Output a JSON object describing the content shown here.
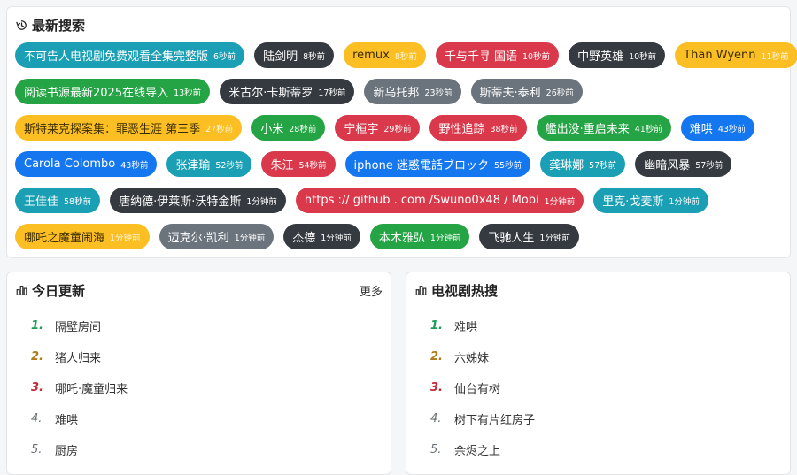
{
  "recent": {
    "title": "最新搜索",
    "rows": [
      [
        {
          "text": "不可告人电视剧免费观看全集完整版",
          "time": "6秒前",
          "color": "teal"
        },
        {
          "text": "陆剑明",
          "time": "8秒前",
          "color": "dark"
        },
        {
          "text": "remux",
          "time": "8秒前",
          "color": "yellow"
        },
        {
          "text": "千与千寻 国语",
          "time": "10秒前",
          "color": "red"
        },
        {
          "text": "中野英雄",
          "time": "10秒前",
          "color": "dark"
        },
        {
          "text": "Than Wyenn",
          "time": "11秒前",
          "color": "yellow"
        }
      ],
      [
        {
          "text": "阅读书源最新2025在线导入",
          "time": "13秒前",
          "color": "green"
        },
        {
          "text": "米古尔·卡斯蒂罗",
          "time": "17秒前",
          "color": "dark"
        },
        {
          "text": "新乌托邦",
          "time": "23秒前",
          "color": "gray"
        },
        {
          "text": "斯蒂夫·泰利",
          "time": "26秒前",
          "color": "gray"
        }
      ],
      [
        {
          "text": "斯特莱克探案集：罪恶生涯 第三季",
          "time": "27秒前",
          "color": "yellow"
        },
        {
          "text": "小米",
          "time": "28秒前",
          "color": "green"
        },
        {
          "text": "宁桓宇",
          "time": "29秒前",
          "color": "red"
        },
        {
          "text": "野性追踪",
          "time": "38秒前",
          "color": "red"
        },
        {
          "text": "艦出没·重启未来",
          "time": "41秒前",
          "color": "green"
        },
        {
          "text": "难哄",
          "time": "43秒前",
          "color": "blue"
        }
      ],
      [
        {
          "text": "Carola Colombo",
          "time": "43秒前",
          "color": "blue"
        },
        {
          "text": "张津瑜",
          "time": "52秒前",
          "color": "teal"
        },
        {
          "text": "朱江",
          "time": "54秒前",
          "color": "red"
        },
        {
          "text": "iphone 迷惑電話ブロック",
          "time": "55秒前",
          "color": "blue"
        },
        {
          "text": "龚琳娜",
          "time": "57秒前",
          "color": "teal"
        },
        {
          "text": "幽暗风暴",
          "time": "57秒前",
          "color": "dark"
        }
      ],
      [
        {
          "text": "王佳佳",
          "time": "58秒前",
          "color": "teal"
        },
        {
          "text": "唐纳德·伊莱斯·沃特金斯",
          "time": "1分钟前",
          "color": "dark"
        },
        {
          "text": "https :// github . com /Swuno0x48 / Mobi",
          "time": "1分钟前",
          "color": "red"
        },
        {
          "text": "里克·戈麦斯",
          "time": "1分钟前",
          "color": "teal"
        }
      ],
      [
        {
          "text": "哪吒之魔童闹海",
          "time": "1分钟前",
          "color": "yellow"
        },
        {
          "text": "迈克尔·凯利",
          "time": "1分钟前",
          "color": "gray"
        },
        {
          "text": "杰德",
          "time": "1分钟前",
          "color": "dark"
        },
        {
          "text": "本木雅弘",
          "time": "1分钟前",
          "color": "green"
        },
        {
          "text": "飞驰人生",
          "time": "1分钟前",
          "color": "dark"
        }
      ]
    ]
  },
  "today": {
    "title": "今日更新",
    "more": "更多",
    "items": [
      {
        "rank": "1.",
        "name": "隔壁房间"
      },
      {
        "rank": "2.",
        "name": "猪人归来"
      },
      {
        "rank": "3.",
        "name": "哪吒·魔童归来"
      },
      {
        "rank": "4.",
        "name": "难哄"
      },
      {
        "rank": "5.",
        "name": "厨房"
      }
    ]
  },
  "tvhot": {
    "title": "电视剧热搜",
    "items": [
      {
        "rank": "1.",
        "name": "难哄"
      },
      {
        "rank": "2.",
        "name": "六姊妹"
      },
      {
        "rank": "3.",
        "name": "仙台有树"
      },
      {
        "rank": "4.",
        "name": "树下有片红房子"
      },
      {
        "rank": "5.",
        "name": "余烬之上"
      }
    ]
  },
  "icons": {
    "recent": "history-icon",
    "list": "bar-chart-icon"
  }
}
